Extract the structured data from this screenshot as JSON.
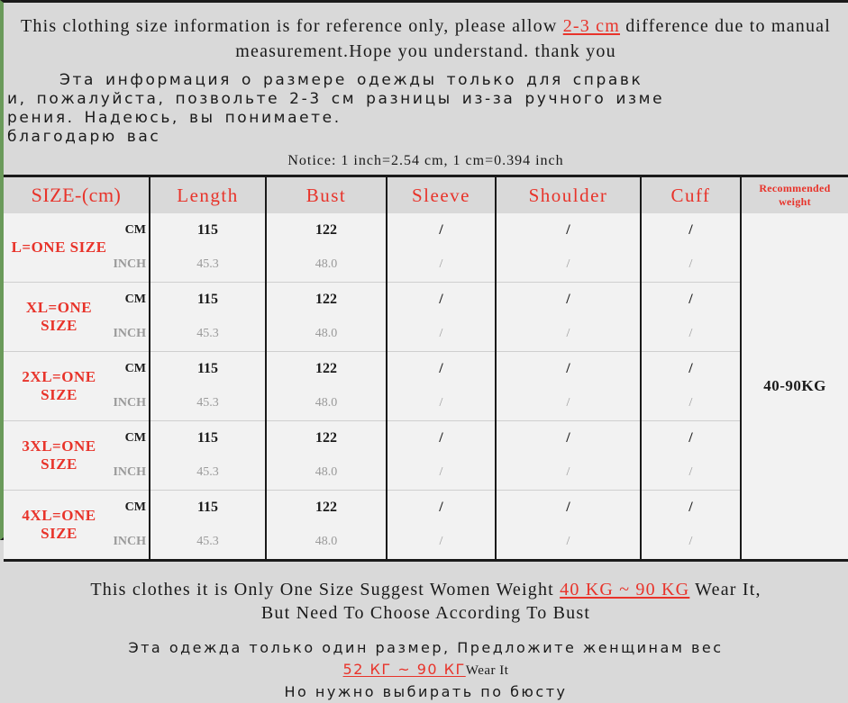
{
  "notice": {
    "en_part1": "This clothing size information is for reference only, please allow ",
    "en_highlight": "2-3 cm",
    "en_part2": " difference due to manual measurement.Hope you understand. thank you",
    "ru_line1": "Эта информация о размере одежды только для справк",
    "ru_line2": "и, пожалуйста, позвольте 2-3 см разницы из-за ручного изме",
    "ru_line3": "рения. Надеюсь, вы понимаете.",
    "ru_line4": "благодарю вас",
    "conversion": "Notice: 1 inch=2.54 cm, 1 cm=0.394 inch"
  },
  "table": {
    "headers": {
      "size": "SIZE-(cm)",
      "length": "Length",
      "bust": "Bust",
      "sleeve": "Sleeve",
      "shoulder": "Shoulder",
      "cuff": "Cuff",
      "weight_line1": "Recommended",
      "weight_line2": "weight"
    },
    "units": {
      "cm": "CM",
      "inch": "INCH"
    },
    "recommended_weight": "40-90KG",
    "rows": [
      {
        "size": "L=ONE SIZE",
        "length_cm": "115",
        "length_inch": "45.3",
        "bust_cm": "122",
        "bust_inch": "48.0",
        "sleeve_cm": "/",
        "sleeve_inch": "/",
        "shoulder_cm": "/",
        "shoulder_inch": "/",
        "cuff_cm": "/",
        "cuff_inch": "/"
      },
      {
        "size": "XL=ONE SIZE",
        "length_cm": "115",
        "length_inch": "45.3",
        "bust_cm": "122",
        "bust_inch": "48.0",
        "sleeve_cm": "/",
        "sleeve_inch": "/",
        "shoulder_cm": "/",
        "shoulder_inch": "/",
        "cuff_cm": "/",
        "cuff_inch": "/"
      },
      {
        "size": "2XL=ONE SIZE",
        "length_cm": "115",
        "length_inch": "45.3",
        "bust_cm": "122",
        "bust_inch": "48.0",
        "sleeve_cm": "/",
        "sleeve_inch": "/",
        "shoulder_cm": "/",
        "shoulder_inch": "/",
        "cuff_cm": "/",
        "cuff_inch": "/"
      },
      {
        "size": "3XL=ONE SIZE",
        "length_cm": "115",
        "length_inch": "45.3",
        "bust_cm": "122",
        "bust_inch": "48.0",
        "sleeve_cm": "/",
        "sleeve_inch": "/",
        "shoulder_cm": "/",
        "shoulder_inch": "/",
        "cuff_cm": "/",
        "cuff_inch": "/"
      },
      {
        "size": "4XL=ONE SIZE",
        "length_cm": "115",
        "length_inch": "45.3",
        "bust_cm": "122",
        "bust_inch": "48.0",
        "sleeve_cm": "/",
        "sleeve_inch": "/",
        "shoulder_cm": "/",
        "shoulder_inch": "/",
        "cuff_cm": "/",
        "cuff_inch": "/"
      }
    ]
  },
  "footer": {
    "en_part1": "This clothes it is Only One Size Suggest Women Weight ",
    "en_highlight": "40 KG ~ 90 KG",
    "en_part2": " Wear It,",
    "en_line2": "But Need To Choose According To Bust",
    "ru_line1": "Эта одежда только один размер, Предложите женщинам вес",
    "ru_highlight": "52 КГ ~ 90 КГ",
    "ru_wear": "Wear It",
    "ru_line3": "Но нужно выбирать по бюсту"
  },
  "colors": {
    "accent_red": "#e8332a",
    "text_black": "#1a1a1a",
    "muted_gray": "#9a9a9a",
    "header_bg": "#d9d9d9",
    "cell_bg": "#f2f2f2"
  }
}
